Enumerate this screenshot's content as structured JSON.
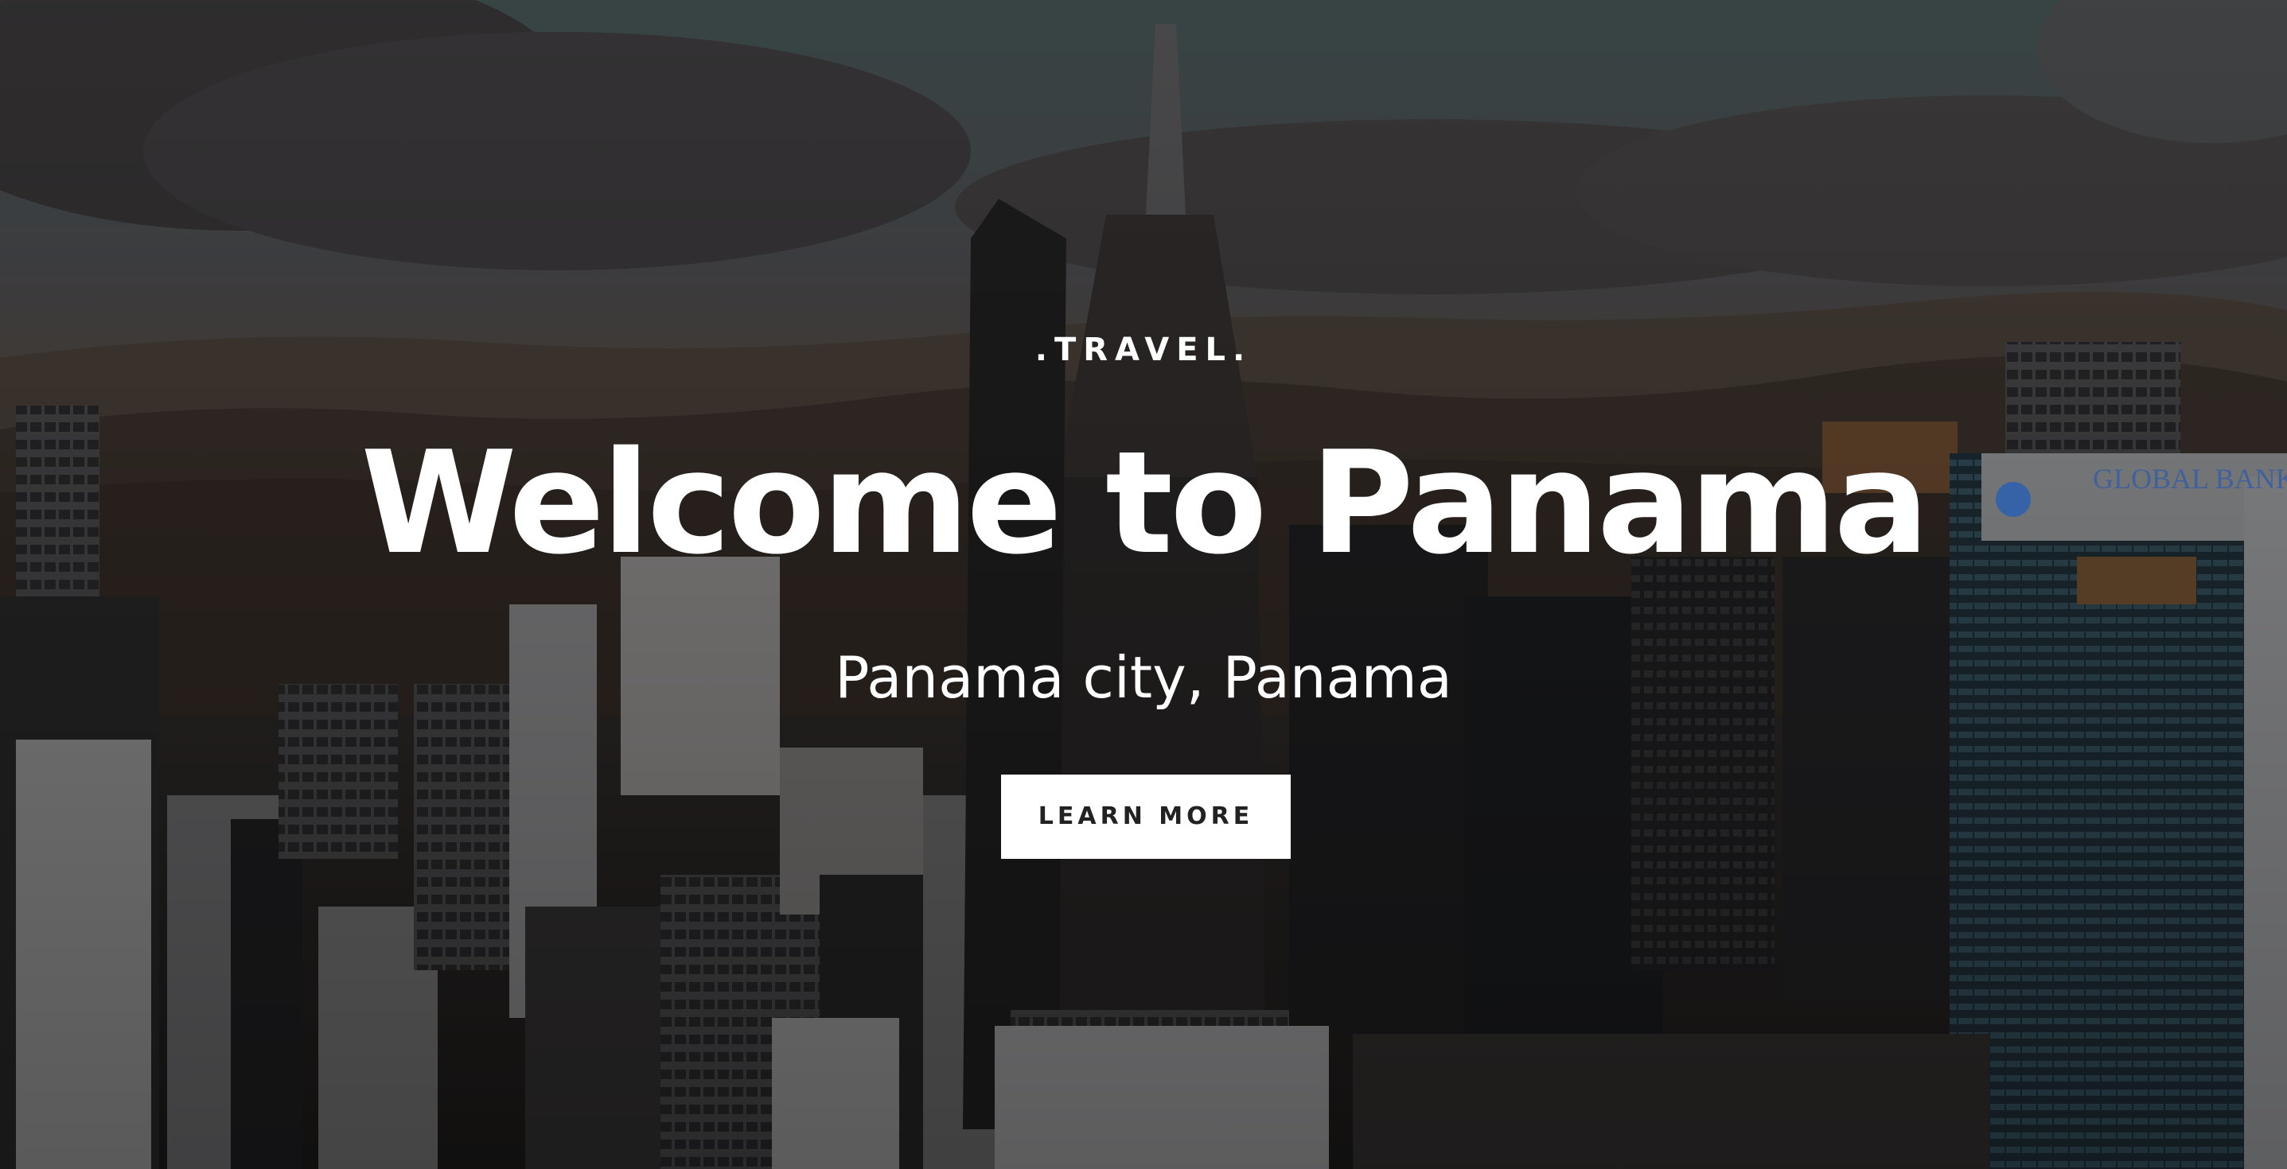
{
  "hero": {
    "eyebrow": ".TRAVEL.",
    "title": "Welcome to Panama",
    "subtitle": "Panama city, Panama",
    "cta_label": "LEARN MORE",
    "background_sign": "GLOBAL BANK"
  },
  "colors": {
    "text": "#ffffff",
    "button_bg": "#ffffff",
    "button_text": "#222222",
    "overlay": "#1a1a1a"
  }
}
